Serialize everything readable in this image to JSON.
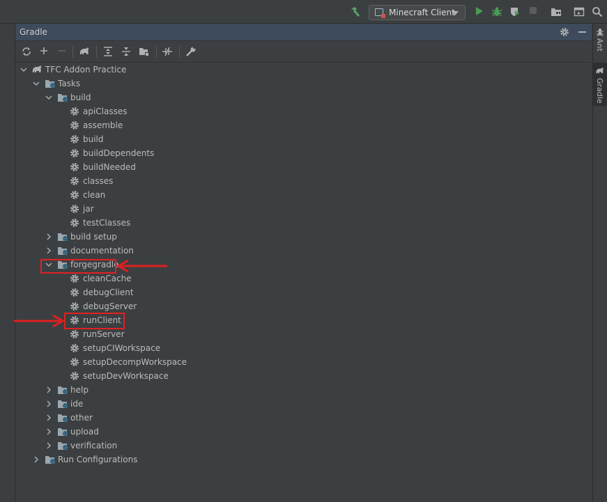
{
  "toolbar": {
    "run_config": "Minecraft Client",
    "icons": [
      "build-hammer-icon",
      "run-config-icon",
      "run-icon",
      "debug-icon",
      "coverage-icon",
      "stop-icon",
      "project-structure-icon",
      "presentation-icon",
      "search-icon"
    ]
  },
  "panel": {
    "title": "Gradle",
    "toolbar_icons": [
      "reload-icon",
      "add-icon",
      "remove-icon",
      "gradle-elephant-icon",
      "expand-all-icon",
      "collapse-all-icon",
      "group-modules-icon",
      "toggle-offline-icon",
      "settings-wrench-icon"
    ]
  },
  "tree": {
    "root": "TFC Addon Practice",
    "tasks": "Tasks",
    "build_group": "build",
    "build_tasks": [
      "apiClasses",
      "assemble",
      "build",
      "buildDependents",
      "buildNeeded",
      "classes",
      "clean",
      "jar",
      "testClasses"
    ],
    "build_setup": "build setup",
    "documentation": "documentation",
    "forgegradle": "forgegradle",
    "forge_tasks": [
      "cleanCache",
      "debugClient",
      "debugServer",
      "runClient",
      "runServer",
      "setupCIWorkspace",
      "setupDecompWorkspace",
      "setupDevWorkspace"
    ],
    "other_groups": [
      "help",
      "ide",
      "other",
      "upload",
      "verification"
    ],
    "run_configurations": "Run Configurations"
  },
  "right_strip": {
    "ant": "Ant",
    "gradle": "Gradle"
  },
  "colors": {
    "annotation": "#e02020",
    "header": "#3d4b5c",
    "background": "#3c3f41"
  }
}
